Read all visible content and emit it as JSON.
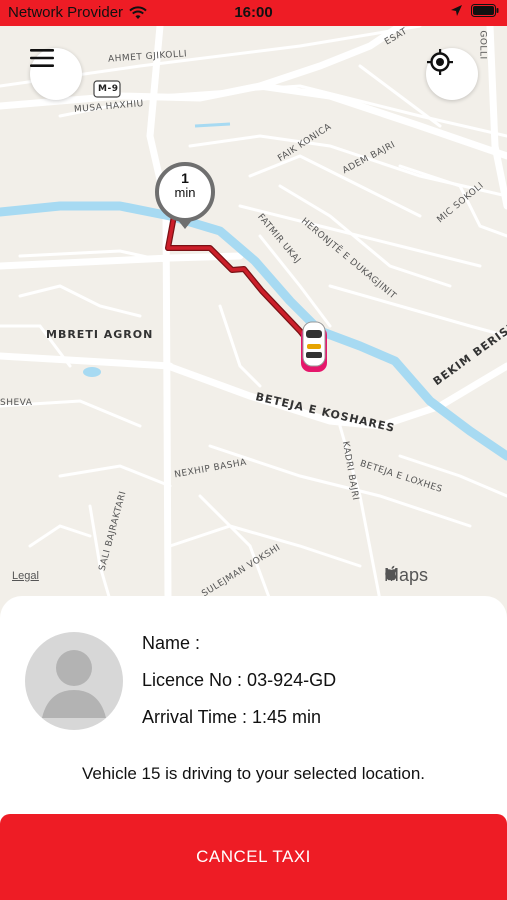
{
  "status_bar": {
    "carrier": "Network Provider",
    "time": "16:00",
    "icons": [
      "wifi-icon",
      "location-arrow-icon",
      "battery-icon"
    ]
  },
  "map": {
    "eta": {
      "value": "1",
      "unit": "min"
    },
    "street_labels": [
      "AHMET GJIKOLLI",
      "M-9",
      "MUSA HAXHIU",
      "FAIK KONICA",
      "ADEM BAJRI",
      "MIC SOKOLI",
      "HERONJTË E DUKAGJINIT",
      "FATMIR UKAJ",
      "MBRETI AGRON",
      "BEKIM BERISHA",
      "SHEVA",
      "BETEJA E KOSHARES",
      "NEXHIP BASHA",
      "KADRI BAJRI",
      "BETEJA E LOXHES",
      "SALI BAJRAKTARI",
      "SULEJMAN VOKSHI",
      "ESAT",
      "GOLLI"
    ],
    "legal_label": "Legal",
    "attribution": "Maps",
    "colors": {
      "route": "#cc1f2a",
      "river": "#a7daf2",
      "accent": "#ee1c25"
    }
  },
  "driver": {
    "name_label": "Name :",
    "licence_label": "Licence No : 03-924-GD",
    "arrival_label": "Arrival Time : 1:45 min"
  },
  "status_message": "Vehicle 15 is driving to your selected location.",
  "cancel_button": "CANCEL TAXI"
}
